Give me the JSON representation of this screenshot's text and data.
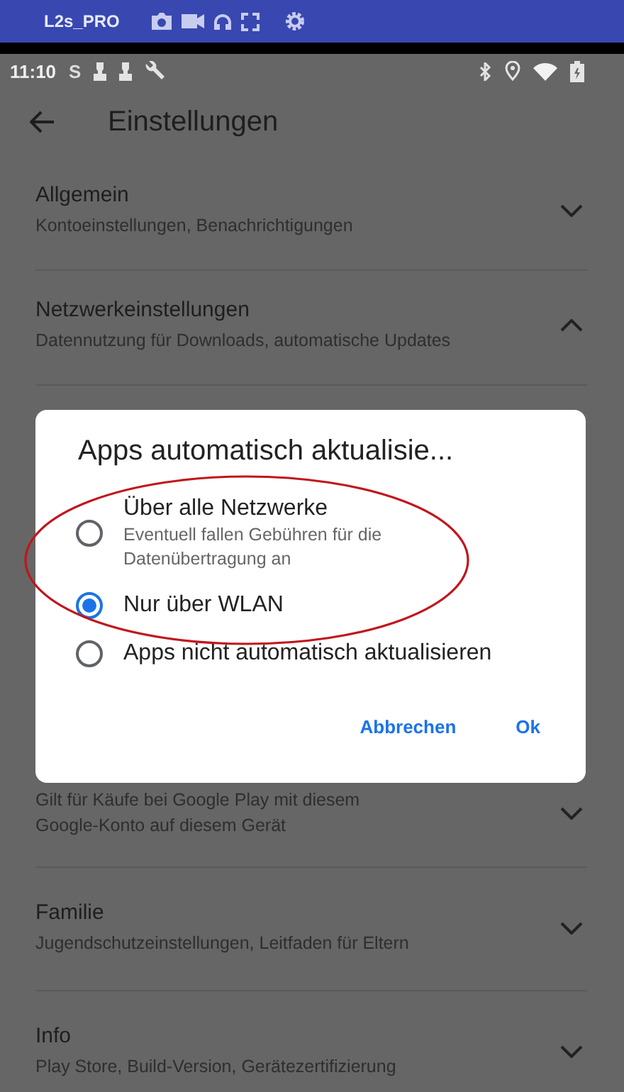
{
  "device_bar": {
    "title": "L2s_PRO"
  },
  "status_bar": {
    "time": "11:10",
    "letter": "S"
  },
  "header": {
    "title": "Einstellungen"
  },
  "sections": [
    {
      "title": "Allgemein",
      "subtitle": "Kontoeinstellungen, Benachrichtigungen",
      "expanded": false
    },
    {
      "title": "Netzwerkeinstellungen",
      "subtitle": "Datennutzung für Downloads, automatische Updates",
      "expanded": true
    },
    {
      "kind": "partial",
      "subtitle": "Gilt für Käufe bei Google Play mit diesem Google-Konto auf diesem Gerät",
      "expanded": false
    },
    {
      "title": "Familie",
      "subtitle": "Jugendschutzeinstellungen, Leitfaden für Eltern",
      "expanded": false
    },
    {
      "title": "Info",
      "subtitle": "Play Store, Build-Version, Gerätezertifizierung",
      "expanded": false
    }
  ],
  "dialog": {
    "title": "Apps automatisch aktualisie...",
    "options": [
      {
        "label": "Über alle Netzwerke",
        "description": "Eventuell fallen Gebühren für die Datenübertragung an",
        "selected": false
      },
      {
        "label": "Nur über WLAN",
        "selected": true
      },
      {
        "label": "Apps nicht automatisch aktualisieren",
        "selected": false
      }
    ],
    "buttons": [
      "Abbrechen",
      "Ok"
    ]
  }
}
